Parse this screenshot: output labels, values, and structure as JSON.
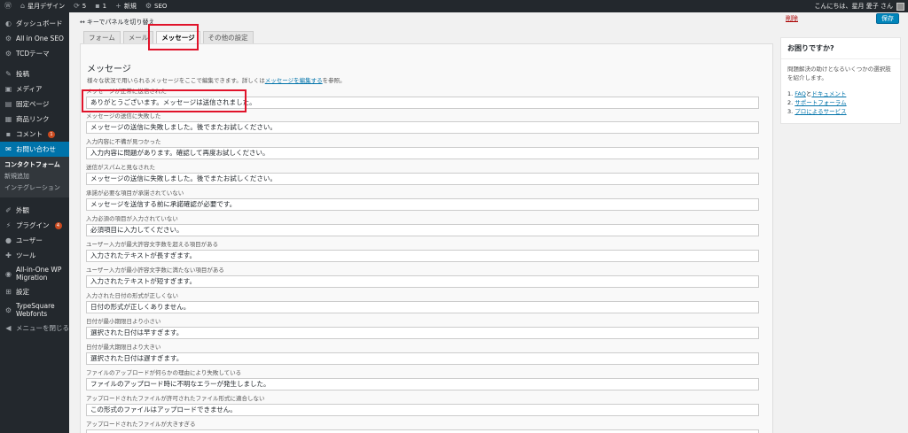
{
  "adminbar": {
    "site_name": "星月デザイン",
    "updates": "5",
    "comments": "1",
    "new_label": "新規",
    "seo_label": "SEO",
    "greeting": "こんにちは、星月 愛子 さん"
  },
  "sidebar": {
    "items": [
      {
        "label": "ダッシュボード",
        "icon": "speedometer-icon"
      },
      {
        "label": "All in One SEO",
        "icon": "seo-icon"
      },
      {
        "label": "TCDテーマ",
        "icon": "gear-icon"
      },
      {
        "label": "投稿",
        "icon": "pin-icon"
      },
      {
        "label": "メディア",
        "icon": "media-icon"
      },
      {
        "label": "固定ページ",
        "icon": "page-icon"
      },
      {
        "label": "商品リンク",
        "icon": "link-icon"
      },
      {
        "label": "コメント",
        "icon": "comment-icon",
        "badge": "1"
      },
      {
        "label": "お問い合わせ",
        "icon": "mail-icon"
      },
      {
        "label": "外観",
        "icon": "brush-icon"
      },
      {
        "label": "プラグイン",
        "icon": "plugin-icon",
        "badge": "4"
      },
      {
        "label": "ユーザー",
        "icon": "user-icon"
      },
      {
        "label": "ツール",
        "icon": "wrench-icon"
      },
      {
        "label": "All-in-One WP Migration",
        "icon": "migration-icon"
      },
      {
        "label": "設定",
        "icon": "settings-icon"
      },
      {
        "label": "TypeSquare Webfonts",
        "icon": "font-icon"
      },
      {
        "label": "メニューを閉じる",
        "icon": "collapse-icon"
      }
    ],
    "submenu": [
      "コンタクトフォーム",
      "新規追加",
      "インテグレーション"
    ]
  },
  "editor": {
    "keyboard_toggle": "キーでパネルを切り替え",
    "tabs": [
      "フォーム",
      "メール",
      "メッセージ",
      "その他の設定"
    ],
    "heading": "メッセージ",
    "desc_before": "様々な状況で用いられるメッセージをここで編集できます。詳しくは",
    "desc_link": "メッセージを編集する",
    "desc_after": "を参照。",
    "fields": [
      {
        "label": "メッセージが正常に送信された",
        "value": "ありがとうございます。メッセージは送信されました。"
      },
      {
        "label": "メッセージの送信に失敗した",
        "value": "メッセージの送信に失敗しました。後でまたお試しください。"
      },
      {
        "label": "入力内容に不備が見つかった",
        "value": "入力内容に問題があります。確認して再度お試しください。"
      },
      {
        "label": "送信がスパムと見なされた",
        "value": "メッセージの送信に失敗しました。後でまたお試しください。"
      },
      {
        "label": "承諾が必要な項目が承諾されていない",
        "value": "メッセージを送信する前に承諾確認が必要です。"
      },
      {
        "label": "入力必須の項目が入力されていない",
        "value": "必須項目に入力してください。"
      },
      {
        "label": "ユーザー入力が最大許容文字数を超える項目がある",
        "value": "入力されたテキストが長すぎます。"
      },
      {
        "label": "ユーザー入力が最小許容文字数に満たない項目がある",
        "value": "入力されたテキストが短すぎます。"
      },
      {
        "label": "入力された日付の形式が正しくない",
        "value": "日付の形式が正しくありません。"
      },
      {
        "label": "日付が最小期限日より小さい",
        "value": "選択された日付は早すぎます。"
      },
      {
        "label": "日付が最大期限日より大きい",
        "value": "選択された日付は遅すぎます。"
      },
      {
        "label": "ファイルのアップロードが何らかの理由により失敗している",
        "value": "ファイルのアップロード時に不明なエラーが発生しました。"
      },
      {
        "label": "アップロードされたファイルが許可されたファイル形式に適合しない",
        "value": "この形式のファイルはアップロードできません。"
      },
      {
        "label": "アップロードされたファイルが大きすぎる",
        "value": ""
      }
    ]
  },
  "right": {
    "delete_label": "削除",
    "save_label": "保存",
    "info_title": "お困りですか?",
    "info_body": "問題解決の助けとなるいくつかの選択肢を紹介します。",
    "links": [
      {
        "num": "1.",
        "parts": [
          "FAQ",
          "と",
          "ドキュメント"
        ]
      },
      {
        "num": "2.",
        "parts": [
          "サポートフォーラム"
        ]
      },
      {
        "num": "3.",
        "parts": [
          "プロによるサービス"
        ]
      }
    ]
  }
}
